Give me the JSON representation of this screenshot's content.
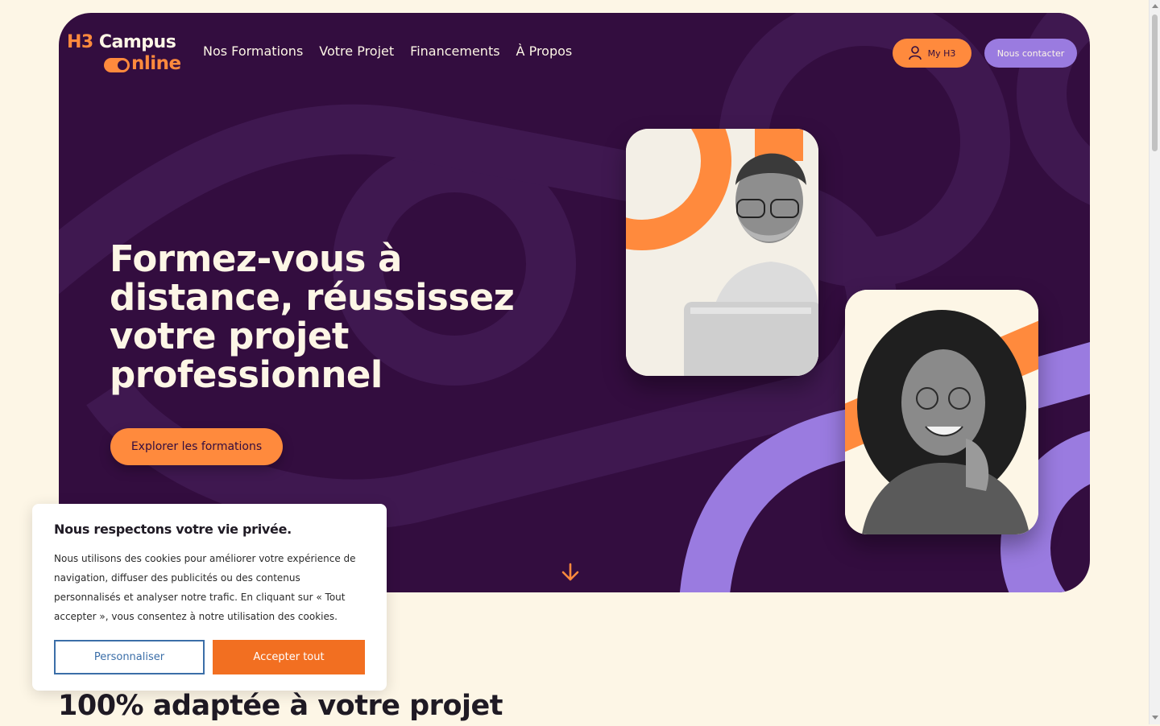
{
  "logo": {
    "line1_brand": "H3",
    "line1_rest": " Campus",
    "line2": "nline"
  },
  "nav": {
    "items": [
      "Nos Formations",
      "Votre Projet",
      "Financements",
      "À Propos"
    ]
  },
  "header": {
    "my_h3_label": "My H3",
    "contact_label": "Nous contacter"
  },
  "hero": {
    "headline": "Formez-vous à distance, réussissez votre projet professionnel",
    "cta_label": "Explorer les formations"
  },
  "cookie": {
    "title": "Nous respectons votre vie privée.",
    "body": "Nous utilisons des cookies pour améliorer votre expérience de navigation, diffuser des publicités ou des contenus personnalisés et analyser notre trafic. En cliquant sur « Tout accepter », vous consentez à notre utilisation des cookies.",
    "customize_label": "Personnaliser",
    "accept_label": "Accepter tout"
  },
  "section": {
    "title": "100% adaptée à votre projet"
  },
  "colors": {
    "page_bg": "#fdf6e6",
    "hero_bg": "#330d3f",
    "orange": "#ff8a3d",
    "purple": "#9a7be0",
    "accept_btn": "#f26f21",
    "customize_border": "#3b6ea8"
  },
  "icons": [
    "user-icon",
    "arrow-down-icon"
  ]
}
